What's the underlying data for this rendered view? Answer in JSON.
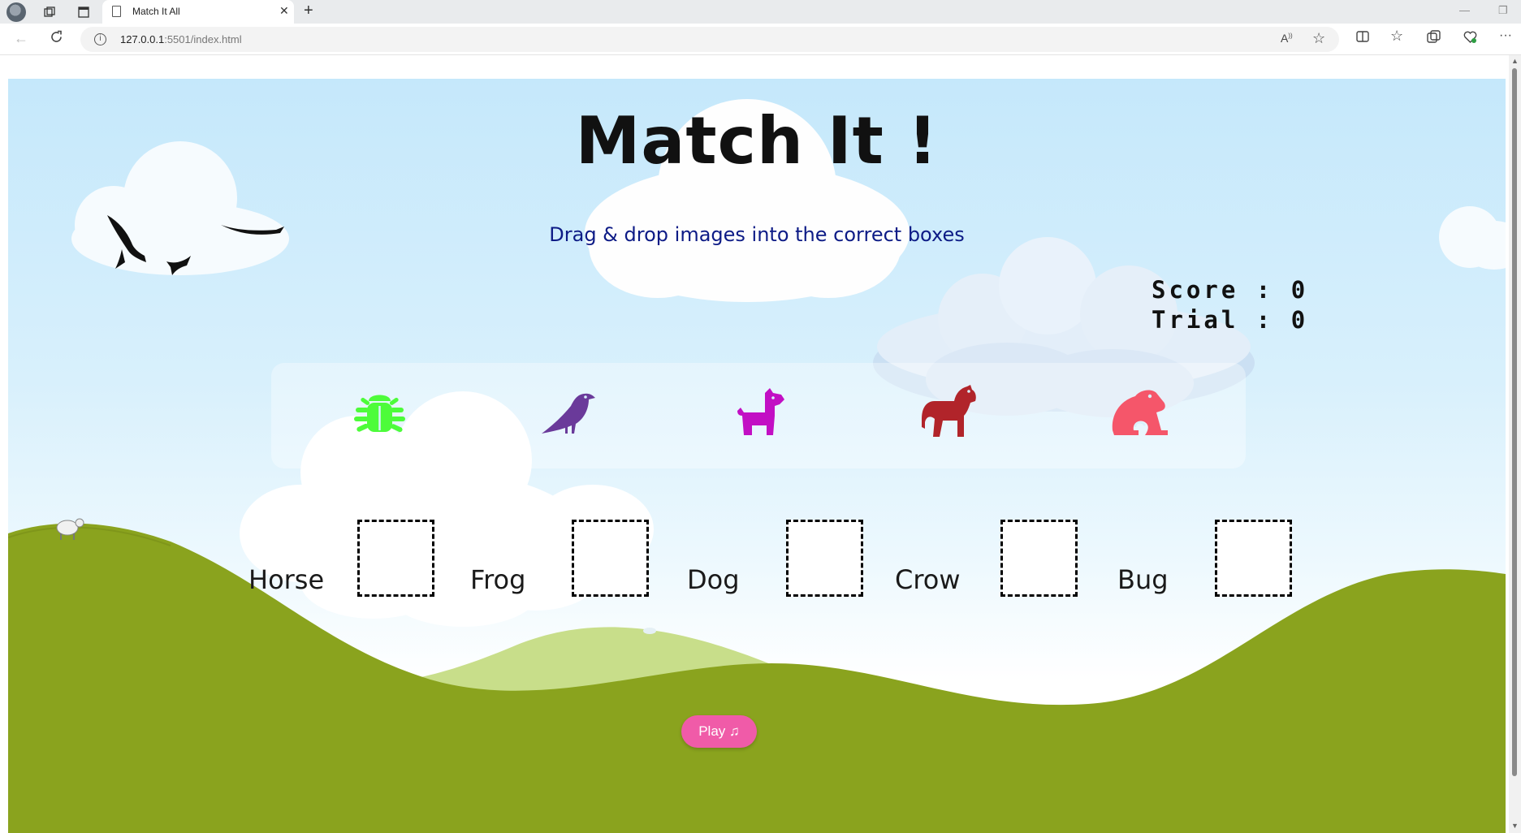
{
  "browser": {
    "tab_title": "Match It All",
    "tab_close": "✕",
    "new_tab": "+",
    "url_host": "127.0.0.1",
    "url_path": ":5501/index.html",
    "minimize": "—",
    "restore": "❐"
  },
  "game": {
    "title": "Match It !",
    "subtitle": "Drag & drop images into the correct boxes",
    "score_label": "Score",
    "score_value": "0",
    "trial_label": "Trial",
    "trial_value": "0",
    "animals": [
      {
        "name": "bug-icon",
        "color": "#4dfc3a"
      },
      {
        "name": "crow-icon",
        "color": "#6a3a9a"
      },
      {
        "name": "dog-icon",
        "color": "#c20fc4"
      },
      {
        "name": "horse-icon",
        "color": "#b1242a"
      },
      {
        "name": "frog-icon",
        "color": "#f5566a"
      }
    ],
    "targets": [
      {
        "label": "Horse"
      },
      {
        "label": "Frog"
      },
      {
        "label": "Dog"
      },
      {
        "label": "Crow"
      },
      {
        "label": "Bug"
      }
    ],
    "play_label": "Play ♫"
  },
  "colors": {
    "sky_top": "#c5e8fb",
    "hill_dark": "#8aa31e",
    "hill_light": "#c8de8a",
    "play_button": "#f05ba8",
    "subtitle": "#0d1b86"
  }
}
